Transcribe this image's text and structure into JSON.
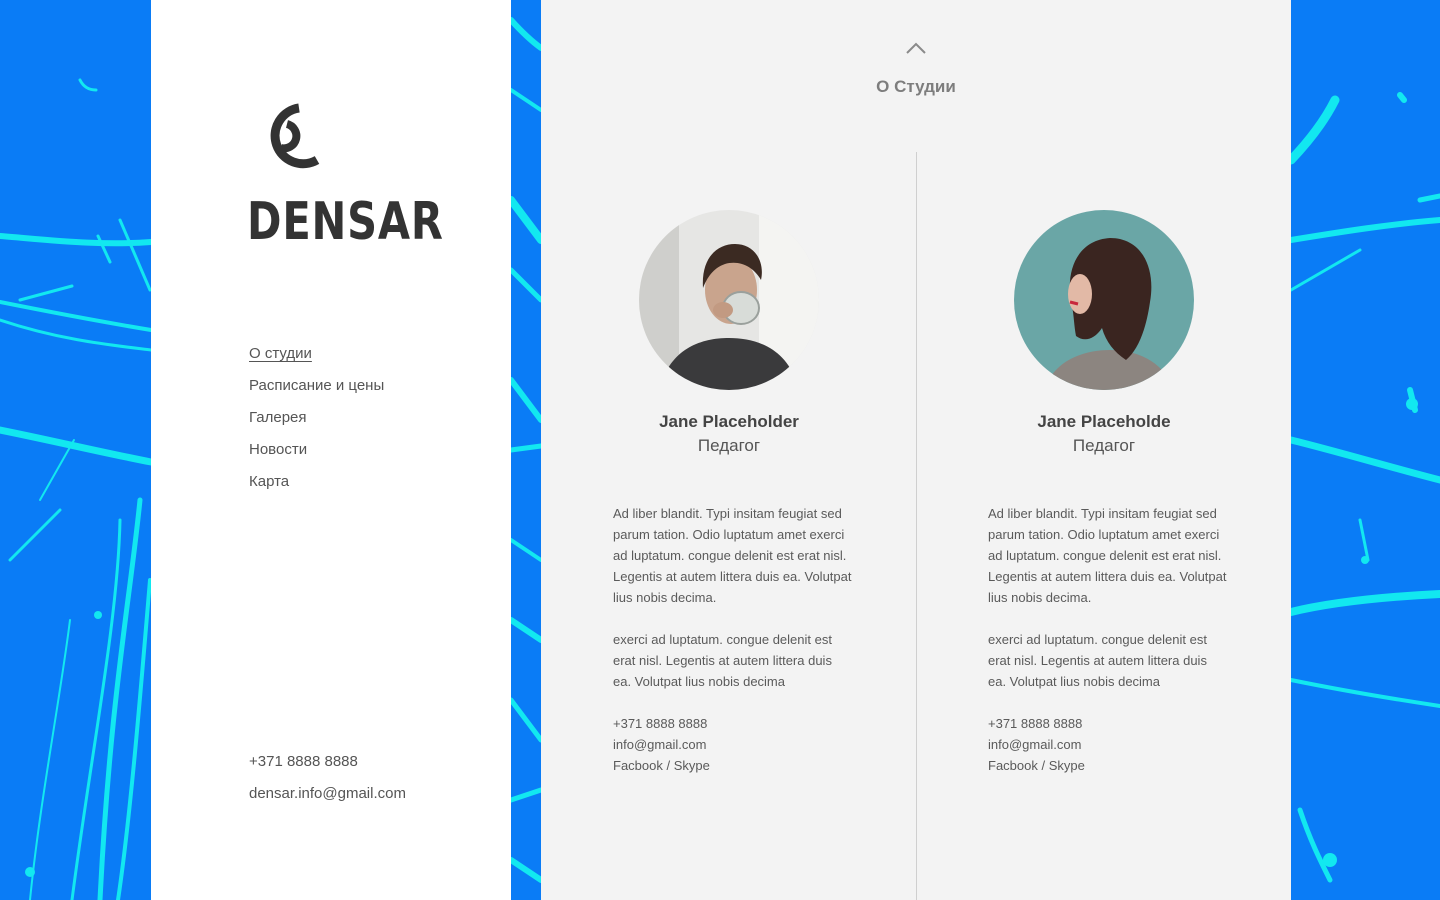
{
  "brand": {
    "name": "DENSAR",
    "logo_icon": "concentric-c-logo-icon"
  },
  "colors": {
    "background_blue": "#0a7cf6",
    "splash_cyan": "#12e8f0",
    "sidebar_bg": "#ffffff",
    "panel_bg": "#f3f3f3",
    "text_dark": "#444444"
  },
  "nav": {
    "items": [
      {
        "label": "О студии",
        "active": true
      },
      {
        "label": "Расписание и цены",
        "active": false
      },
      {
        "label": "Галерея",
        "active": false
      },
      {
        "label": "Новости",
        "active": false
      },
      {
        "label": "Карта",
        "active": false
      }
    ]
  },
  "sidebar_contacts": {
    "phone": "+371 8888 8888",
    "email": "densar.info@gmail.com"
  },
  "section": {
    "up_icon": "chevron-up-icon",
    "title": "О Студии"
  },
  "team": [
    {
      "name": "Jane Placeholder",
      "role": "Педагог",
      "bio_1": "Ad liber blandit. Typi insitam feugiat sed parum tation. Odio luptatum amet exerci ad luptatum. congue delenit est erat nisl. Legentis at autem littera duis ea. Volutpat lius nobis decima.",
      "bio_2": "exerci ad luptatum. congue delenit est erat nisl. Legentis at autem littera duis ea. Volutpat lius nobis decima",
      "phone": "+371 8888 8888",
      "email": "info@gmail.com",
      "social": "Facbook / Skype"
    },
    {
      "name": "Jane Placeholde",
      "role": "Педагог",
      "bio_1": "Ad liber blandit. Typi insitam feugiat sed parum tation. Odio luptatum amet exerci ad luptatum. congue delenit est erat nisl. Legentis at autem littera duis ea. Volutpat lius nobis decima.",
      "bio_2": "exerci ad luptatum. congue delenit est erat nisl. Legentis at autem littera duis ea. Volutpat lius nobis decima",
      "phone": "+371 8888 8888",
      "email": "info@gmail.com",
      "social": "Facbook / Skype"
    }
  ]
}
